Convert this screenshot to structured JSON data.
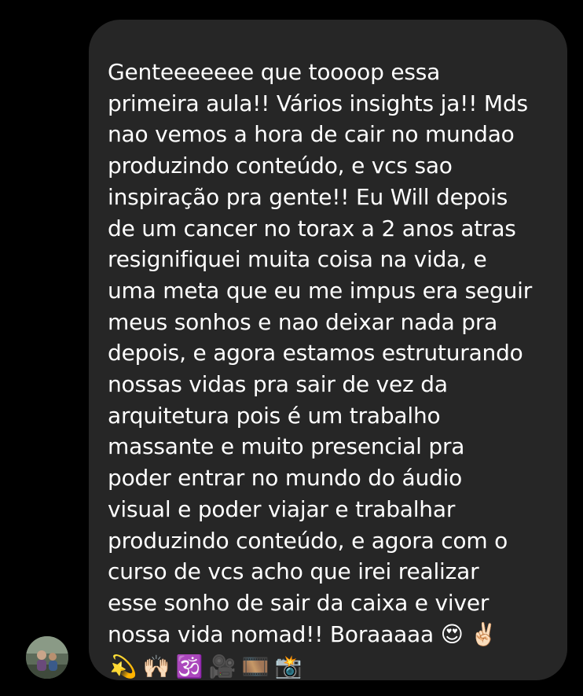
{
  "message": {
    "lines": "Genteeeeeee que toooop essa\nprimeira aula!! Vários insights ja!! Mds\nnao vemos a hora de cair no mundao\nproduzindo conteúdo, e vcs sao\ninspiração pra gente!! Eu Will depois\nde um cancer no torax a 2 anos atras\nresignifiquei muita coisa na vida, e\numa meta que eu me impus era seguir\nmeus sonhos e nao deixar nada pra\ndepois, e agora estamos estruturando\nnossas vidas pra sair de vez da\narquitetura pois é um trabalho\nmassante e muito presencial pra\npoder entrar no mundo do áudio\nvisual e poder viajar e trabalhar\nproduzindo conteúdo, e agora com o\ncurso de vcs acho que irei realizar\nesse sonho de sair da caixa e viver\nnossa vida nomad!! Boraaaaa 😍 ✌🏻",
    "emojis": [
      "💫",
      "🙌🏻",
      "🕉️",
      "🎥",
      "🎞️",
      "📸"
    ]
  },
  "colors": {
    "background": "#000000",
    "bubble": "#262626",
    "text": "#ffffff"
  }
}
